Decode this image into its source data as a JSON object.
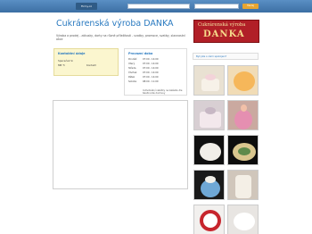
{
  "topbar": {
    "brand": "Firmy.cz",
    "links": "Hledání · Mapy · Katalog",
    "search_button": "Hledej"
  },
  "header": {
    "title": "Cukrárenská výroba DANKA",
    "subtitle": "Výroba a prodej - zákusky, dorty na různé příležitosti - svatby, promoce, svatby, slavnostní akce"
  },
  "banner": {
    "top": "Cukrárenská výroba",
    "main": "DANKA"
  },
  "contact": {
    "title": "Kontaktní údaje",
    "name": "Spaceček Si",
    "phone_label": "Mobil",
    "phone_label_short": "MB Ti",
    "value": "Kontakt"
  },
  "hours": {
    "title": "Provozní doba",
    "rows": [
      {
        "day": "Pondělí",
        "time": "07:00 - 14:00"
      },
      {
        "day": "Úterý",
        "time": "07:00 - 14:00"
      },
      {
        "day": "Středa",
        "time": "07:00 - 14:00"
      },
      {
        "day": "Čtvrtek",
        "time": "07:00 - 14:00"
      },
      {
        "day": "Pátek",
        "time": "07:00 - 14:00"
      },
      {
        "day": "Sobota",
        "time": "08:00 - 11:00"
      }
    ],
    "note": "Individuální nabídky na zakázku dle telefonické domluvy"
  },
  "sidebar": {
    "link": "Byli jste s námi spokojeni?"
  },
  "colors": {
    "accent": "#2a7ac0",
    "banner": "#b11f27"
  }
}
